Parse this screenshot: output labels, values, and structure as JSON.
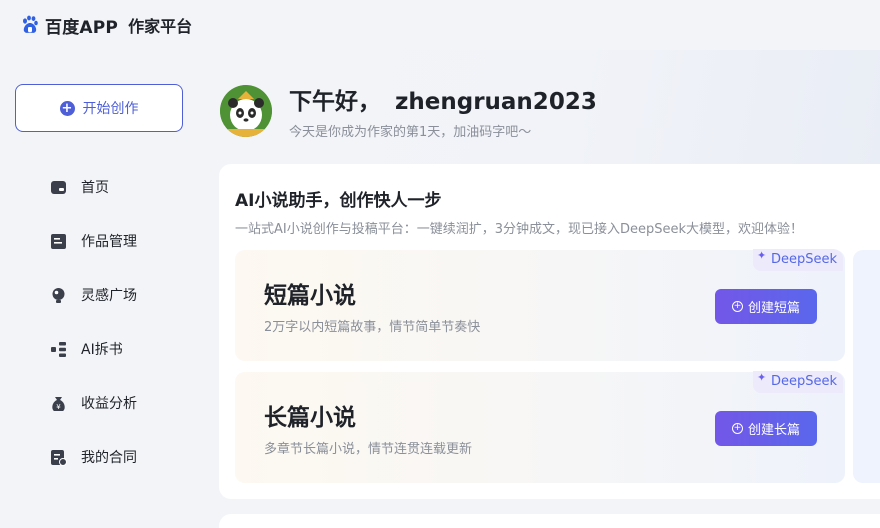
{
  "brand": {
    "name": "百度APP",
    "platform": "作家平台"
  },
  "sidebar": {
    "start_button": "开始创作",
    "items": [
      {
        "label": "首页",
        "icon": "home-icon"
      },
      {
        "label": "作品管理",
        "icon": "book-icon"
      },
      {
        "label": "灵感广场",
        "icon": "bulb-icon"
      },
      {
        "label": "AI拆书",
        "icon": "ai-split-icon"
      },
      {
        "label": "收益分析",
        "icon": "money-bag-icon"
      },
      {
        "label": "我的合同",
        "icon": "contract-icon"
      }
    ]
  },
  "header": {
    "greeting": "下午好，",
    "username": "zhengruan2023",
    "subtitle": "今天是你成为作家的第1天，加油码字吧～"
  },
  "ai_section": {
    "title": "AI小说助手，创作快人一步",
    "subtitle": "一站式AI小说创作与投稿平台：一键续润扩，3分钟成文，现已接入DeepSeek大模型，欢迎体验！",
    "cards": [
      {
        "title": "短篇小说",
        "desc": "2万字以内短篇故事，情节简单节奏快",
        "button": "创建短篇",
        "badge": "DeepSeek"
      },
      {
        "title": "长篇小说",
        "desc": "多章节长篇小说，情节连贯连载更新",
        "button": "创建长篇",
        "badge": "DeepSeek"
      }
    ]
  },
  "colors": {
    "accent": "#4e5fd8",
    "button_gradient_start": "#7357e8",
    "button_gradient_end": "#5a67ec"
  }
}
